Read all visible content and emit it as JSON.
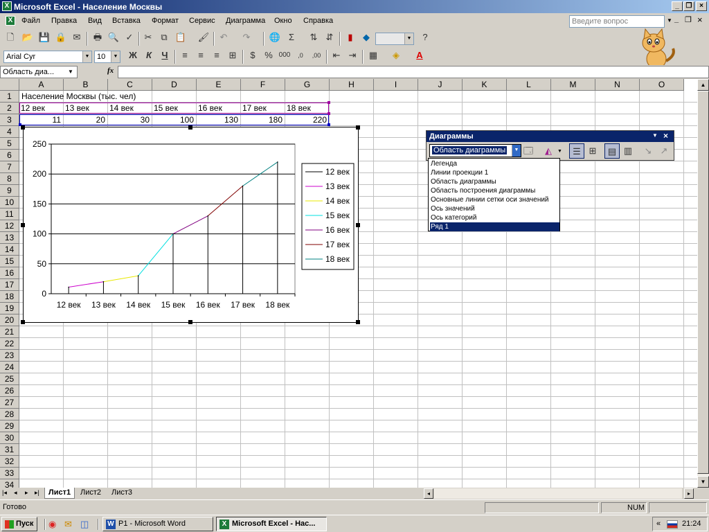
{
  "window": {
    "title": "Microsoft Excel - Население Москвы"
  },
  "menu": {
    "items": [
      "Файл",
      "Правка",
      "Вид",
      "Вставка",
      "Формат",
      "Сервис",
      "Диаграмма",
      "Окно",
      "Справка"
    ],
    "ask_placeholder": "Введите вопрос"
  },
  "format": {
    "font": "Arial Cyr",
    "size": "10",
    "bold": "Ж",
    "italic": "К",
    "underline": "Ч"
  },
  "formula": {
    "name_box": "Область диа...",
    "fx": "fx",
    "value": ""
  },
  "sheet": {
    "columns": [
      "A",
      "B",
      "C",
      "D",
      "E",
      "F",
      "G",
      "H",
      "I",
      "J",
      "K",
      "L",
      "M",
      "N",
      "O"
    ],
    "rows": [
      "1",
      "2",
      "3",
      "4",
      "5",
      "6",
      "7",
      "8",
      "9",
      "10",
      "11",
      "12",
      "13",
      "14",
      "15",
      "16",
      "17",
      "18",
      "19",
      "20",
      "21",
      "22",
      "23",
      "24",
      "25",
      "26",
      "27",
      "28",
      "29",
      "30",
      "31",
      "32",
      "33",
      "34"
    ],
    "a1": "Население Москвы (тыс. чел)",
    "headers": [
      "12 век",
      "13 век",
      "14 век",
      "15 век",
      "16 век",
      "17 век",
      "18 век"
    ],
    "values": [
      "11",
      "20",
      "30",
      "100",
      "130",
      "180",
      "220"
    ]
  },
  "chart_data": {
    "type": "line",
    "categories": [
      "12 век",
      "13 век",
      "14 век",
      "15 век",
      "16 век",
      "17 век",
      "18 век"
    ],
    "values": [
      11,
      20,
      30,
      100,
      130,
      180,
      220
    ],
    "ylim": [
      0,
      250
    ],
    "yticks": [
      "0",
      "50",
      "100",
      "150",
      "200",
      "250"
    ],
    "grid": true,
    "drop_lines": true,
    "legend_position": "right",
    "legend": [
      "12 век",
      "13 век",
      "14 век",
      "15 век",
      "16 век",
      "17 век",
      "18 век"
    ],
    "segment_colors": [
      "#cc00cc",
      "#e8e800",
      "#00e0e0",
      "#800080",
      "#800000",
      "#008080"
    ],
    "legend_colors": [
      "#000000",
      "#cc00cc",
      "#e8e800",
      "#00e0e0",
      "#800080",
      "#800000",
      "#008080"
    ],
    "title": "",
    "xlabel": "",
    "ylabel": ""
  },
  "chart_toolbar": {
    "title": "Диаграммы",
    "selected": "Область диаграммы",
    "dropdown_items": [
      "Легенда",
      "Линии проекции 1",
      "Область диаграммы",
      "Область построения диаграммы",
      "Основные линии сетки оси значений",
      "Ось значений",
      "Ось категорий",
      "Ряд 1"
    ],
    "highlighted_index": 7
  },
  "tabs": [
    "Лист1",
    "Лист2",
    "Лист3"
  ],
  "status": {
    "ready": "Готово",
    "num": "NUM"
  },
  "taskbar": {
    "start": "Пуск",
    "word": "P1 - Microsoft Word",
    "excel": "Microsoft Excel - Нас...",
    "time": "21:24",
    "chevrons": "«"
  },
  "colors": {
    "title_start": "#0a246a",
    "title_end": "#a6caf0",
    "selection": "#0a246a",
    "excel_green": "#1d7b3a"
  }
}
